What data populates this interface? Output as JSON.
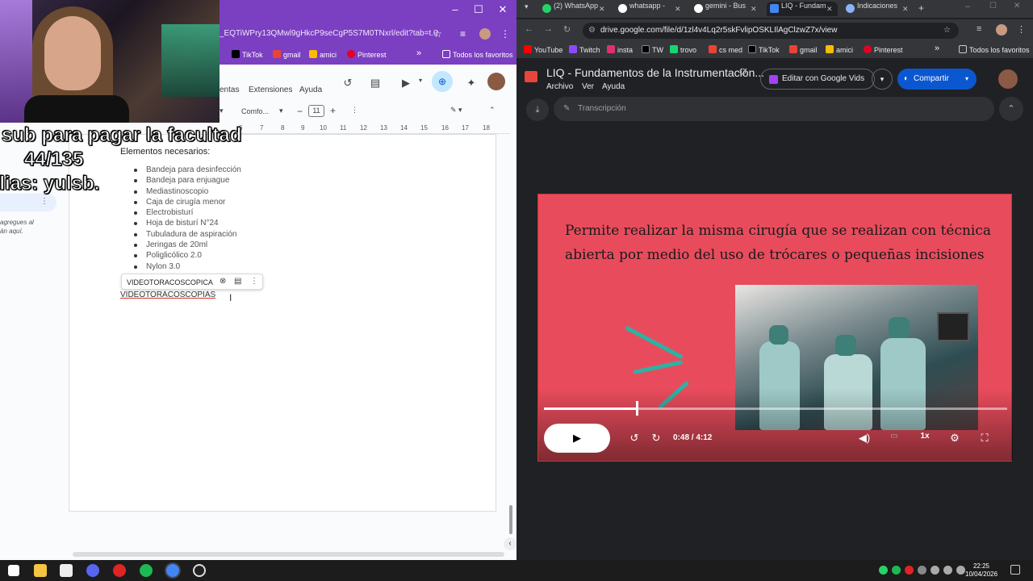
{
  "left_window": {
    "url": "_EQTiWPry13QMwl9gHkcP9seCgP5S7M0TNxrl/edit?tab=t.0",
    "bookmarks": [
      "TikTok",
      "gmail",
      "amici",
      "Pinterest"
    ],
    "all_bookmarks": "Todos los favoritos",
    "menu": [
      "entas",
      "Extensiones",
      "Ayuda"
    ],
    "style_select": "Comfo...",
    "font_size": "11",
    "ruler_ticks": [
      "6",
      "7",
      "8",
      "9",
      "10",
      "11",
      "12",
      "13",
      "14",
      "15",
      "16",
      "17",
      "18"
    ],
    "side_note": "agregues al\nán aquí.",
    "doc": {
      "heading": "Elementos necesarios:",
      "items": [
        "Bandeja para desinfección",
        "Bandeja para enjuague",
        "Mediastinoscopio",
        "Caja de cirugía menor",
        "Electrobisturí",
        "Hoja de bisturí N°24",
        "Tubuladura de aspiración",
        "Jeringas de 20ml",
        "Poliglicólico 2.0",
        "Nylon 3.0"
      ],
      "suggestion": "VIDEOTORACOSCOPICA",
      "typed": "VIDEOTORACOSCOPIAS"
    }
  },
  "overlay": {
    "line1": "sub para pagar la facultad",
    "line2": "44/135",
    "line3": "alias: yulsb."
  },
  "right_window": {
    "tabs": [
      "(2) WhatsApp",
      "whatsapp - ",
      "gemini - Bus",
      "LIQ - Fundam",
      "Indicaciones"
    ],
    "url": "drive.google.com/file/d/1zl4v4Lq2r5skFvlipOSKLIlAgClzwZ7x/view",
    "bookmarks": [
      "YouTube",
      "Twitch",
      "insta",
      "TW",
      "trovo",
      "cs med",
      "TikTok",
      "gmail",
      "amici",
      "Pinterest"
    ],
    "all_bookmarks": "Todos los favoritos",
    "doc_title": "LIQ - Fundamentos de la Instrumentación...",
    "menu": [
      "Archivo",
      "Ver",
      "Ayuda"
    ],
    "edit_vids": "Editar con Google Vids",
    "share": "Compartir",
    "transcript": "Transcripción",
    "slide_text": "Permite realizar la misma cirugía que se realizan con técnica abierta por medio del uso de trócares o pequeñas incisiones",
    "time_current": "0:48",
    "time_total": "/ 4:12",
    "speed": "1x",
    "progress": 0.2
  },
  "taskbar": {
    "time": "22:25",
    "date": "10/04/2026"
  },
  "colors": {
    "left_chrome": "#7b3fc1",
    "slide_bg": "#e84c5c",
    "share_blue": "#0b57d0"
  }
}
